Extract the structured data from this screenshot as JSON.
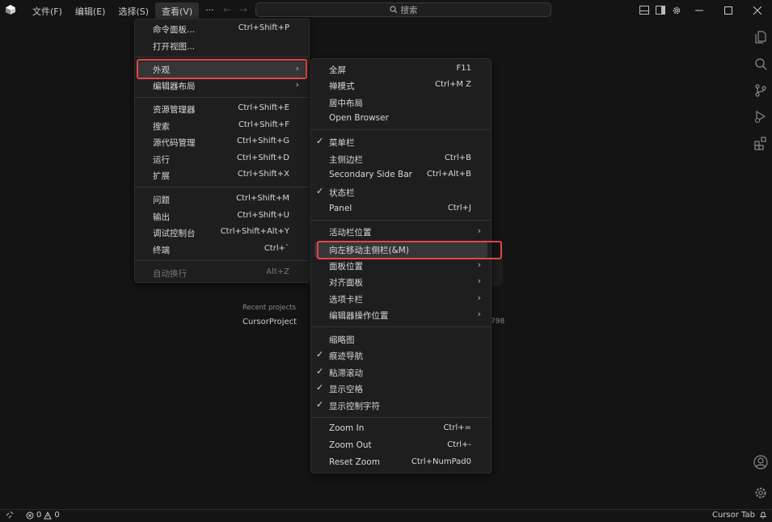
{
  "menubar": {
    "items": [
      {
        "label": "文件(F)"
      },
      {
        "label": "编辑(E)"
      },
      {
        "label": "选择(S)"
      },
      {
        "label": "查看(V)"
      }
    ],
    "more": "···"
  },
  "search": {
    "label": "搜索"
  },
  "view_menu": {
    "items": [
      {
        "label": "命令面板...",
        "shortcut": "Ctrl+Shift+P"
      },
      {
        "label": "打开视图...",
        "shortcut": ""
      },
      {
        "label": "外观",
        "shortcut": ""
      },
      {
        "label": "编辑器布局",
        "shortcut": ""
      },
      {
        "label": "资源管理器",
        "shortcut": "Ctrl+Shift+E"
      },
      {
        "label": "搜索",
        "shortcut": "Ctrl+Shift+F"
      },
      {
        "label": "源代码管理",
        "shortcut": "Ctrl+Shift+G"
      },
      {
        "label": "运行",
        "shortcut": "Ctrl+Shift+D"
      },
      {
        "label": "扩展",
        "shortcut": "Ctrl+Shift+X"
      },
      {
        "label": "问题",
        "shortcut": "Ctrl+Shift+M"
      },
      {
        "label": "输出",
        "shortcut": "Ctrl+Shift+U"
      },
      {
        "label": "调试控制台",
        "shortcut": "Ctrl+Shift+Alt+Y"
      },
      {
        "label": "终端",
        "shortcut": "Ctrl+`"
      },
      {
        "label": "自动换行",
        "shortcut": "Alt+Z"
      }
    ]
  },
  "appearance_menu": {
    "items": [
      {
        "label": "全屏",
        "shortcut": "F11"
      },
      {
        "label": "禅模式",
        "shortcut": "Ctrl+M Z"
      },
      {
        "label": "居中布局",
        "shortcut": ""
      },
      {
        "label": "Open Browser",
        "shortcut": ""
      },
      {
        "label": "菜单栏",
        "shortcut": "",
        "checked": true
      },
      {
        "label": "主侧边栏",
        "shortcut": "Ctrl+B"
      },
      {
        "label": "Secondary Side Bar",
        "shortcut": "Ctrl+Alt+B"
      },
      {
        "label": "状态栏",
        "shortcut": "",
        "checked": true
      },
      {
        "label": "Panel",
        "shortcut": "Ctrl+J"
      },
      {
        "label": "活动栏位置",
        "shortcut": ""
      },
      {
        "label": "向左移动主侧栏(&M)",
        "shortcut": ""
      },
      {
        "label": "面板位置",
        "shortcut": ""
      },
      {
        "label": "对齐面板",
        "shortcut": ""
      },
      {
        "label": "选项卡栏",
        "shortcut": ""
      },
      {
        "label": "编辑器操作位置",
        "shortcut": ""
      },
      {
        "label": "缩略图",
        "shortcut": ""
      },
      {
        "label": "痕迹导航",
        "shortcut": "",
        "checked": true
      },
      {
        "label": "粘滞滚动",
        "shortcut": "",
        "checked": true
      },
      {
        "label": "显示空格",
        "shortcut": "",
        "checked": true
      },
      {
        "label": "显示控制字符",
        "shortcut": "",
        "checked": true
      },
      {
        "label": "Zoom In",
        "shortcut": "Ctrl+="
      },
      {
        "label": "Zoom Out",
        "shortcut": "Ctrl+-"
      },
      {
        "label": "Reset Zoom",
        "shortcut": "Ctrl+NumPad0"
      }
    ],
    "check_glyph": "✓",
    "submenu_glyph": "›"
  },
  "welcome": {
    "recent_label": "Recent projects",
    "project_name": "CursorProject",
    "path_fragment": "798"
  },
  "statusbar": {
    "errors": "0",
    "warnings": "0",
    "right_label": "Cursor Tab"
  },
  "colors": {
    "background": "#141414",
    "menu_bg": "#1e1e1e",
    "highlight": "#363636",
    "annotation_red": "#e4444c"
  }
}
